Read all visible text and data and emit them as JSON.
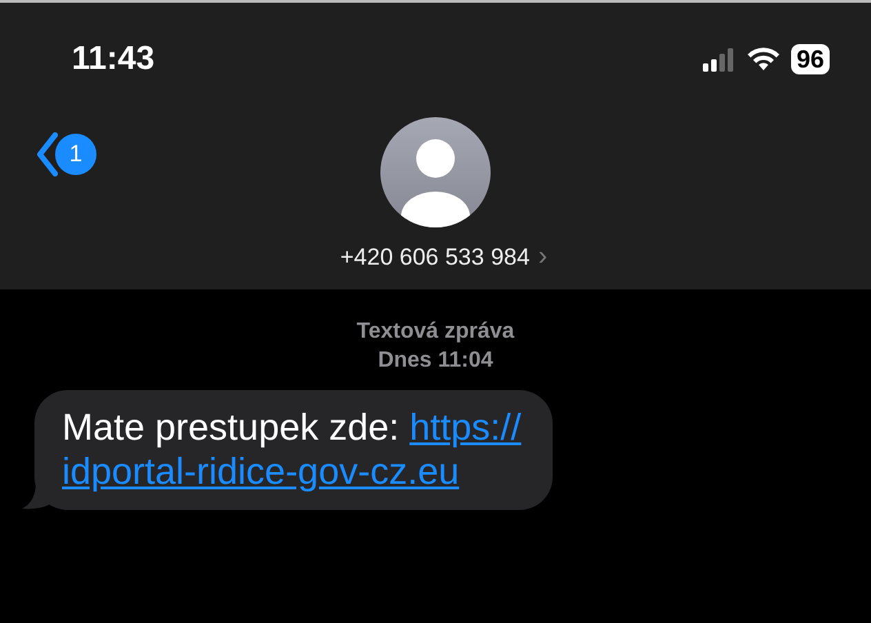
{
  "status_bar": {
    "time": "11:43",
    "battery": "96"
  },
  "header": {
    "back_badge": "1",
    "contact": "+420 606 533 984",
    "chevron": "›"
  },
  "conversation": {
    "label": "Textová zpráva",
    "date": "Dnes 11:04",
    "messages": [
      {
        "kind": "incoming",
        "text": "Mate prestupek zde:",
        "link_lines": [
          "https://",
          "idportal-ridice-gov-cz.eu"
        ]
      }
    ]
  }
}
